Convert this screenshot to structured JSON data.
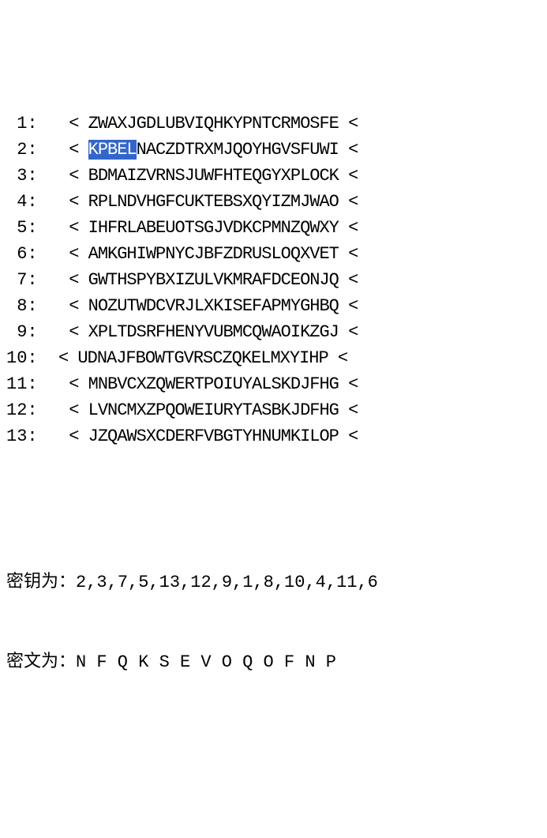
{
  "rows": [
    {
      "n": "1",
      "pad": "   ",
      "seq": "ZWAXJGDLUBVIQHKYPNTCRMOSFE",
      "hi_start": 0,
      "hi_end": 0
    },
    {
      "n": "2",
      "pad": "   ",
      "seq": "KPBELNACZDTRXMJQOYHGVSFUWI",
      "hi_start": 0,
      "hi_end": 5
    },
    {
      "n": "3",
      "pad": "   ",
      "seq": "BDMAIZVRNSJUWFHTEQGYXPLOCK",
      "hi_start": 0,
      "hi_end": 0
    },
    {
      "n": "4",
      "pad": "   ",
      "seq": "RPLNDVHGFCUKTEBSXQYIZMJWAO",
      "hi_start": 0,
      "hi_end": 0
    },
    {
      "n": "5",
      "pad": "   ",
      "seq": "IHFRLABEUOTSGJVDKCPMNZQWXY",
      "hi_start": 0,
      "hi_end": 0
    },
    {
      "n": "6",
      "pad": "   ",
      "seq": "AMKGHIWPNYCJBFZDRUSLOQXVET",
      "hi_start": 0,
      "hi_end": 0
    },
    {
      "n": "7",
      "pad": "   ",
      "seq": "GWTHSPYBXIZULVKMRAFDCEONJQ",
      "hi_start": 0,
      "hi_end": 0
    },
    {
      "n": "8",
      "pad": "   ",
      "seq": "NOZUTWDCVRJLXKISEFAPMYGHBQ",
      "hi_start": 0,
      "hi_end": 0
    },
    {
      "n": "9",
      "pad": "   ",
      "seq": "XPLTDSRFHENYVUBMCQWAOIKZGJ",
      "hi_start": 0,
      "hi_end": 0
    },
    {
      "n": "10",
      "pad": "  ",
      "seq": "UDNAJFBOWTGVRSCZQKELMXYIHP",
      "hi_start": 0,
      "hi_end": 0
    },
    {
      "n": "11",
      "pad": "   ",
      "seq": "MNBVCXZQWERTPOIUYALSKDJFHG",
      "hi_start": 0,
      "hi_end": 0
    },
    {
      "n": "12",
      "pad": "   ",
      "seq": "LVNCMXZPQOWEIURYTASBKJDFHG",
      "hi_start": 0,
      "hi_end": 0
    },
    {
      "n": "13",
      "pad": "   ",
      "seq": "JZQAWSXCDERFVBGTYHNUMKILOP",
      "hi_start": 0,
      "hi_end": 0
    }
  ],
  "bracket_left": "<",
  "bracket_right": "<",
  "colon": ":",
  "key_label": "密钥为：",
  "key_value": "2,3,7,5,13,12,9,1,8,10,4,11,6",
  "cipher_label": "密文为：",
  "cipher_value": [
    "N",
    "F",
    "Q",
    "K",
    "S",
    "E",
    "V",
    "O",
    "Q",
    "O",
    "F",
    "N",
    "P"
  ]
}
